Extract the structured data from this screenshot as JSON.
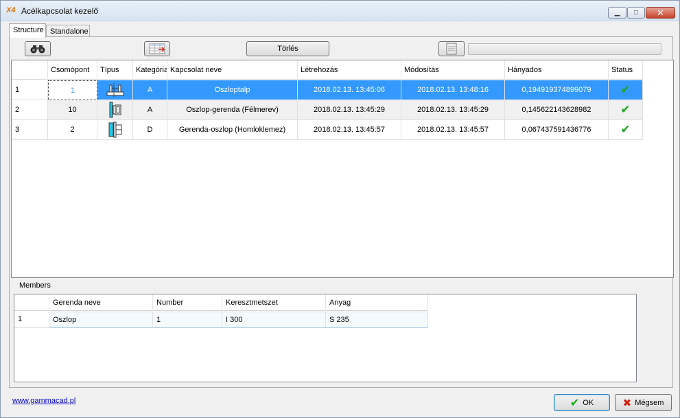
{
  "window": {
    "app_icon": "X4",
    "title": "Acélkapcsolat kezelő"
  },
  "tabs": [
    {
      "label": "Structure"
    },
    {
      "label": "Standalone"
    }
  ],
  "toolbar": {
    "find_icon": "binoculars-icon",
    "table_icon": "table-export-icon",
    "delete_label": "Törlés",
    "export_icon": "document-icon"
  },
  "grid": {
    "headers": [
      "",
      "Csomópont",
      "Típus",
      "Kategória",
      "Kapcsolat neve",
      "Létrehozás",
      "Módosítás",
      "Hányados",
      "Status"
    ],
    "rows": [
      {
        "num": "1",
        "csomopont": "1",
        "tipus_icon": "base-plate-icon",
        "kategoria": "A",
        "nev": "Oszloptalp",
        "letrehozas": "2018.02.13.  13:45:06",
        "modositas": "2018.02.13.  13:48:16",
        "hanyados": "0,194919374899079",
        "status": "✔"
      },
      {
        "num": "2",
        "csomopont": "10",
        "tipus_icon": "column-beam-icon",
        "kategoria": "A",
        "nev": "Oszlop-gerenda (Félmerev)",
        "letrehozas": "2018.02.13.  13:45:29",
        "modositas": "2018.02.13.  13:45:29",
        "hanyados": "0,145622143628982",
        "status": "✔"
      },
      {
        "num": "3",
        "csomopont": "2",
        "tipus_icon": "beam-column-icon",
        "kategoria": "D",
        "nev": "Gerenda-oszlop (Homloklemez)",
        "letrehozas": "2018.02.13.  13:45:57",
        "modositas": "2018.02.13.  13:45:57",
        "hanyados": "0,067437591436776",
        "status": "✔"
      }
    ]
  },
  "members": {
    "label": "Members",
    "headers": [
      "",
      "Gerenda neve",
      "Number",
      "Keresztmetszet",
      "Anyag"
    ],
    "rows": [
      {
        "num": "1",
        "gerenda": "Oszlop",
        "number": "1",
        "keresztmetszet": "I 300",
        "anyag": "S 235"
      }
    ]
  },
  "footer": {
    "link": "www.gammacad.pl",
    "ok_label": "OK",
    "cancel_label": "Mégsem"
  },
  "colors": {
    "selection": "#3399ff",
    "check": "#1fa51f",
    "link": "#0000cc"
  }
}
